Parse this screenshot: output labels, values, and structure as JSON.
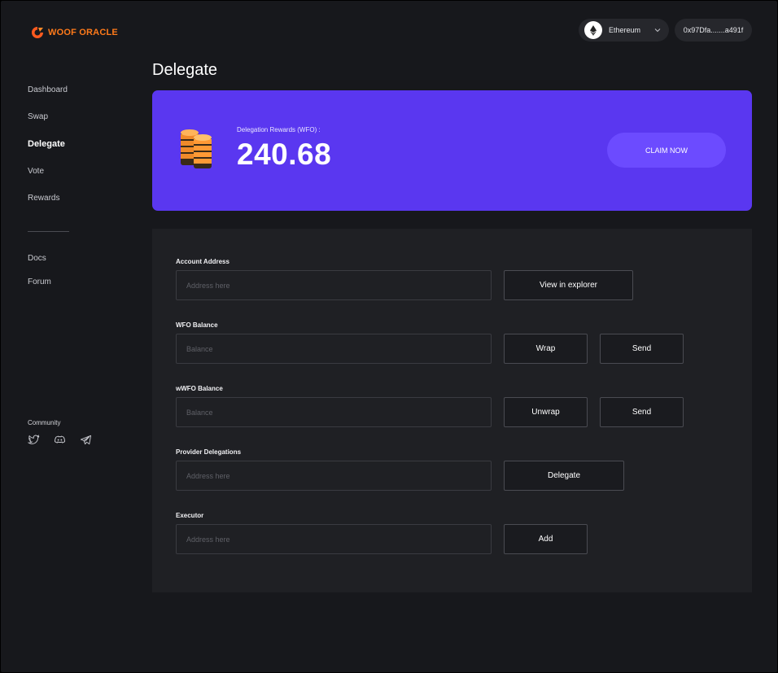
{
  "brand": {
    "name": "WOOF ORACLE",
    "color": "#ff7a1a"
  },
  "sidebar": {
    "items": [
      {
        "label": "Dashboard",
        "active": false
      },
      {
        "label": "Swap",
        "active": false
      },
      {
        "label": "Delegate",
        "active": true
      },
      {
        "label": "Vote",
        "active": false
      },
      {
        "label": "Rewards",
        "active": false
      }
    ],
    "secondary": [
      {
        "label": "Docs"
      },
      {
        "label": "Forum"
      }
    ],
    "community_label": "Community",
    "social_icons": [
      "twitter-icon",
      "discord-icon",
      "telegram-icon"
    ]
  },
  "header": {
    "network": {
      "label": "Ethereum",
      "icon": "ethereum-icon"
    },
    "wallet": "0x97Dfa.......a491f"
  },
  "page_title": "Delegate",
  "rewards": {
    "label": "Delegation Rewards (WFO) :",
    "value": "240.68",
    "claim_label": "CLAIM NOW",
    "card_color": "#5a37f0"
  },
  "form": {
    "account": {
      "label": "Account Address",
      "placeholder": "Address here",
      "button": "View in explorer"
    },
    "wfo": {
      "label": "WFO Balance",
      "placeholder": "Balance",
      "wrap": "Wrap",
      "send": "Send"
    },
    "wwfo": {
      "label": "wWFO Balance",
      "placeholder": "Balance",
      "unwrap": "Unwrap",
      "send": "Send"
    },
    "provider": {
      "label": "Provider Delegations",
      "placeholder": "Address here",
      "button": "Delegate"
    },
    "executor": {
      "label": "Executor",
      "placeholder": "Address here",
      "button": "Add"
    }
  }
}
